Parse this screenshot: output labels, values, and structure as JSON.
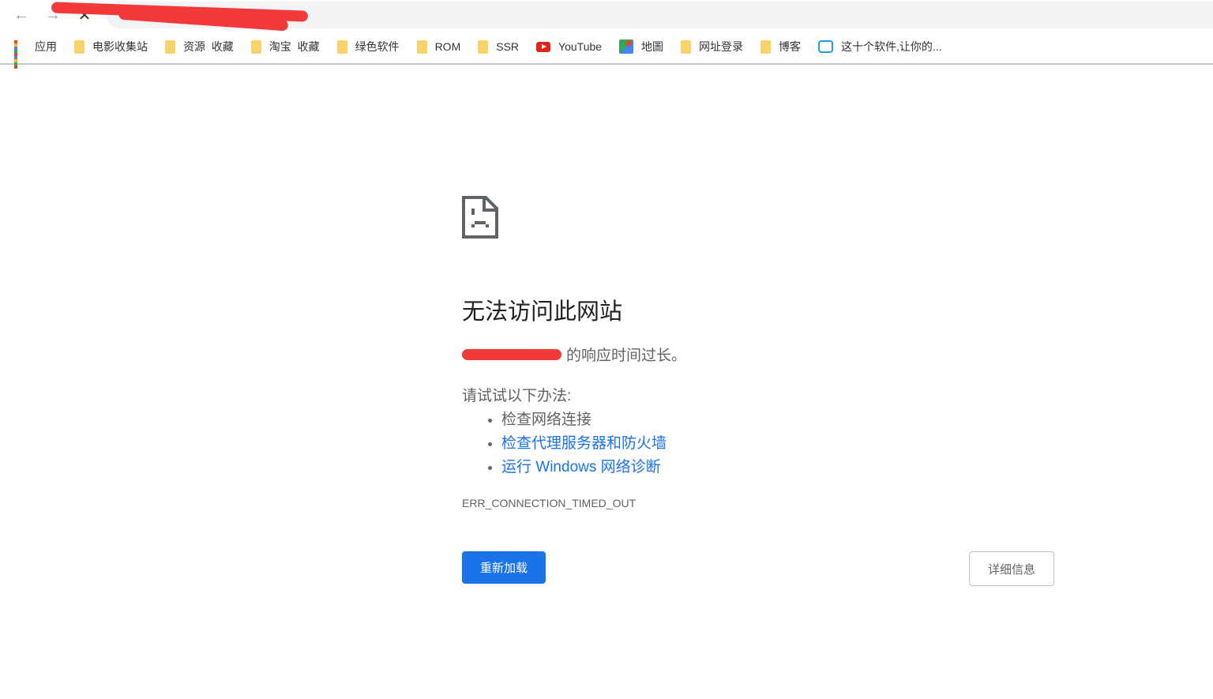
{
  "toolbar": {
    "back": "←",
    "forward": "→",
    "stop": "✕"
  },
  "bookmarks": [
    {
      "label": "应用",
      "icon": "apps-icon"
    },
    {
      "label": "电影收集站",
      "icon": "folder-icon"
    },
    {
      "label": "资源  收藏",
      "icon": "folder-icon"
    },
    {
      "label": "淘宝  收藏",
      "icon": "folder-icon"
    },
    {
      "label": "绿色软件",
      "icon": "folder-icon"
    },
    {
      "label": "ROM",
      "icon": "folder-icon"
    },
    {
      "label": "SSR",
      "icon": "folder-icon"
    },
    {
      "label": "YouTube",
      "icon": "youtube-icon"
    },
    {
      "label": "地圖",
      "icon": "maps-icon"
    },
    {
      "label": "网址登录",
      "icon": "folder-icon"
    },
    {
      "label": "博客",
      "icon": "folder-icon"
    },
    {
      "label": "这十个软件,让你的...",
      "icon": "bilibili-icon"
    }
  ],
  "error": {
    "title": "无法访问此网站",
    "description": "的响应时间过长。",
    "try_label": "请试试以下办法:",
    "suggestions": [
      "检查网络连接",
      "检查代理服务器和防火墙",
      "运行 Windows 网络诊断"
    ],
    "code": "ERR_CONNECTION_TIMED_OUT",
    "reload_label": "重新加载",
    "details_label": "详细信息"
  },
  "colors": {
    "accent": "#1a73e8",
    "redaction": "#f23a3a"
  }
}
